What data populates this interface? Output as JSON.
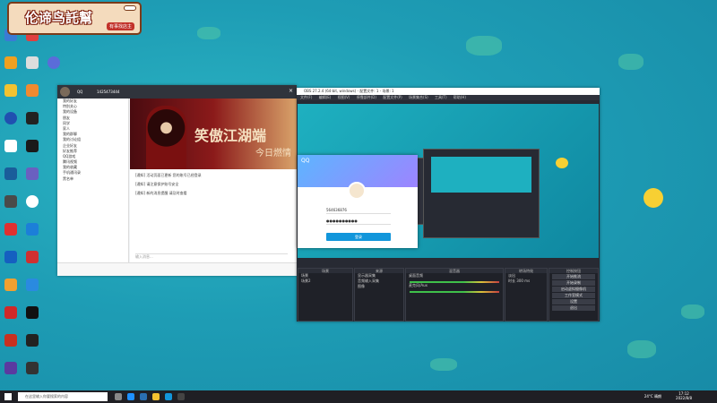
{
  "logo": {
    "title": "伦谛鸟託幫",
    "badge": "有事找店主"
  },
  "qq": {
    "title": "QQ",
    "user": "1425473444",
    "banner_big": "笑傲江湖端",
    "banner_sub": "今日燃情",
    "side_items": [
      "我的好友",
      "特别关心",
      "我的设备",
      "朋友",
      "同学",
      "家人",
      "我的群聊",
      "我的讨论组",
      "企业好友",
      "好友推荐",
      "QQ游戏",
      "腾讯视频",
      "我的收藏",
      "手机通讯录",
      "黑名单"
    ],
    "messages": [
      "[通知] 活动页面已更新 您的账号已经登录",
      "[通知] 请注意保护账号安全",
      "[通知] 新的消息提醒 请及时查看"
    ],
    "input_placeholder": "输入消息..."
  },
  "obs": {
    "title": "OBS 27.2.4 (64-bit, windows) - 配置文件: 1 - 场景: 1",
    "menu": "文件(F) 编辑(E) 视图(V) 停靠部件(D) 配置文件(P) 场景集合(S) 工具(T) 帮助(H)",
    "scenes_title": "场景",
    "scenes": [
      "场景",
      "场景2"
    ],
    "sources_title": "来源",
    "sources": [
      "显示器采集",
      "音频输入采集",
      "图像"
    ],
    "mixer_title": "混音器",
    "mixer": [
      "桌面音频",
      "麦克风/Aux"
    ],
    "trans_title": "转场特效",
    "trans": [
      "淡出",
      "时长 300 ms"
    ],
    "controls_title": "控制按钮",
    "controls": [
      "开始推流",
      "开始录制",
      "启动虚拟摄像机",
      "工作室模式",
      "设置",
      "退出"
    ]
  },
  "login": {
    "brand": "QQ",
    "account": "564636876",
    "password": "●●●●●●●●●●",
    "button": "登录"
  },
  "taskbar": {
    "search": "在这里输入你要搜索的内容",
    "weather": "24°C 晴朗",
    "time": "17:12",
    "date": "2022/8/8"
  },
  "colors": {
    "desktop": "#1e9db5",
    "obs_bg": "#272a33",
    "qq_top": "#30343c"
  }
}
